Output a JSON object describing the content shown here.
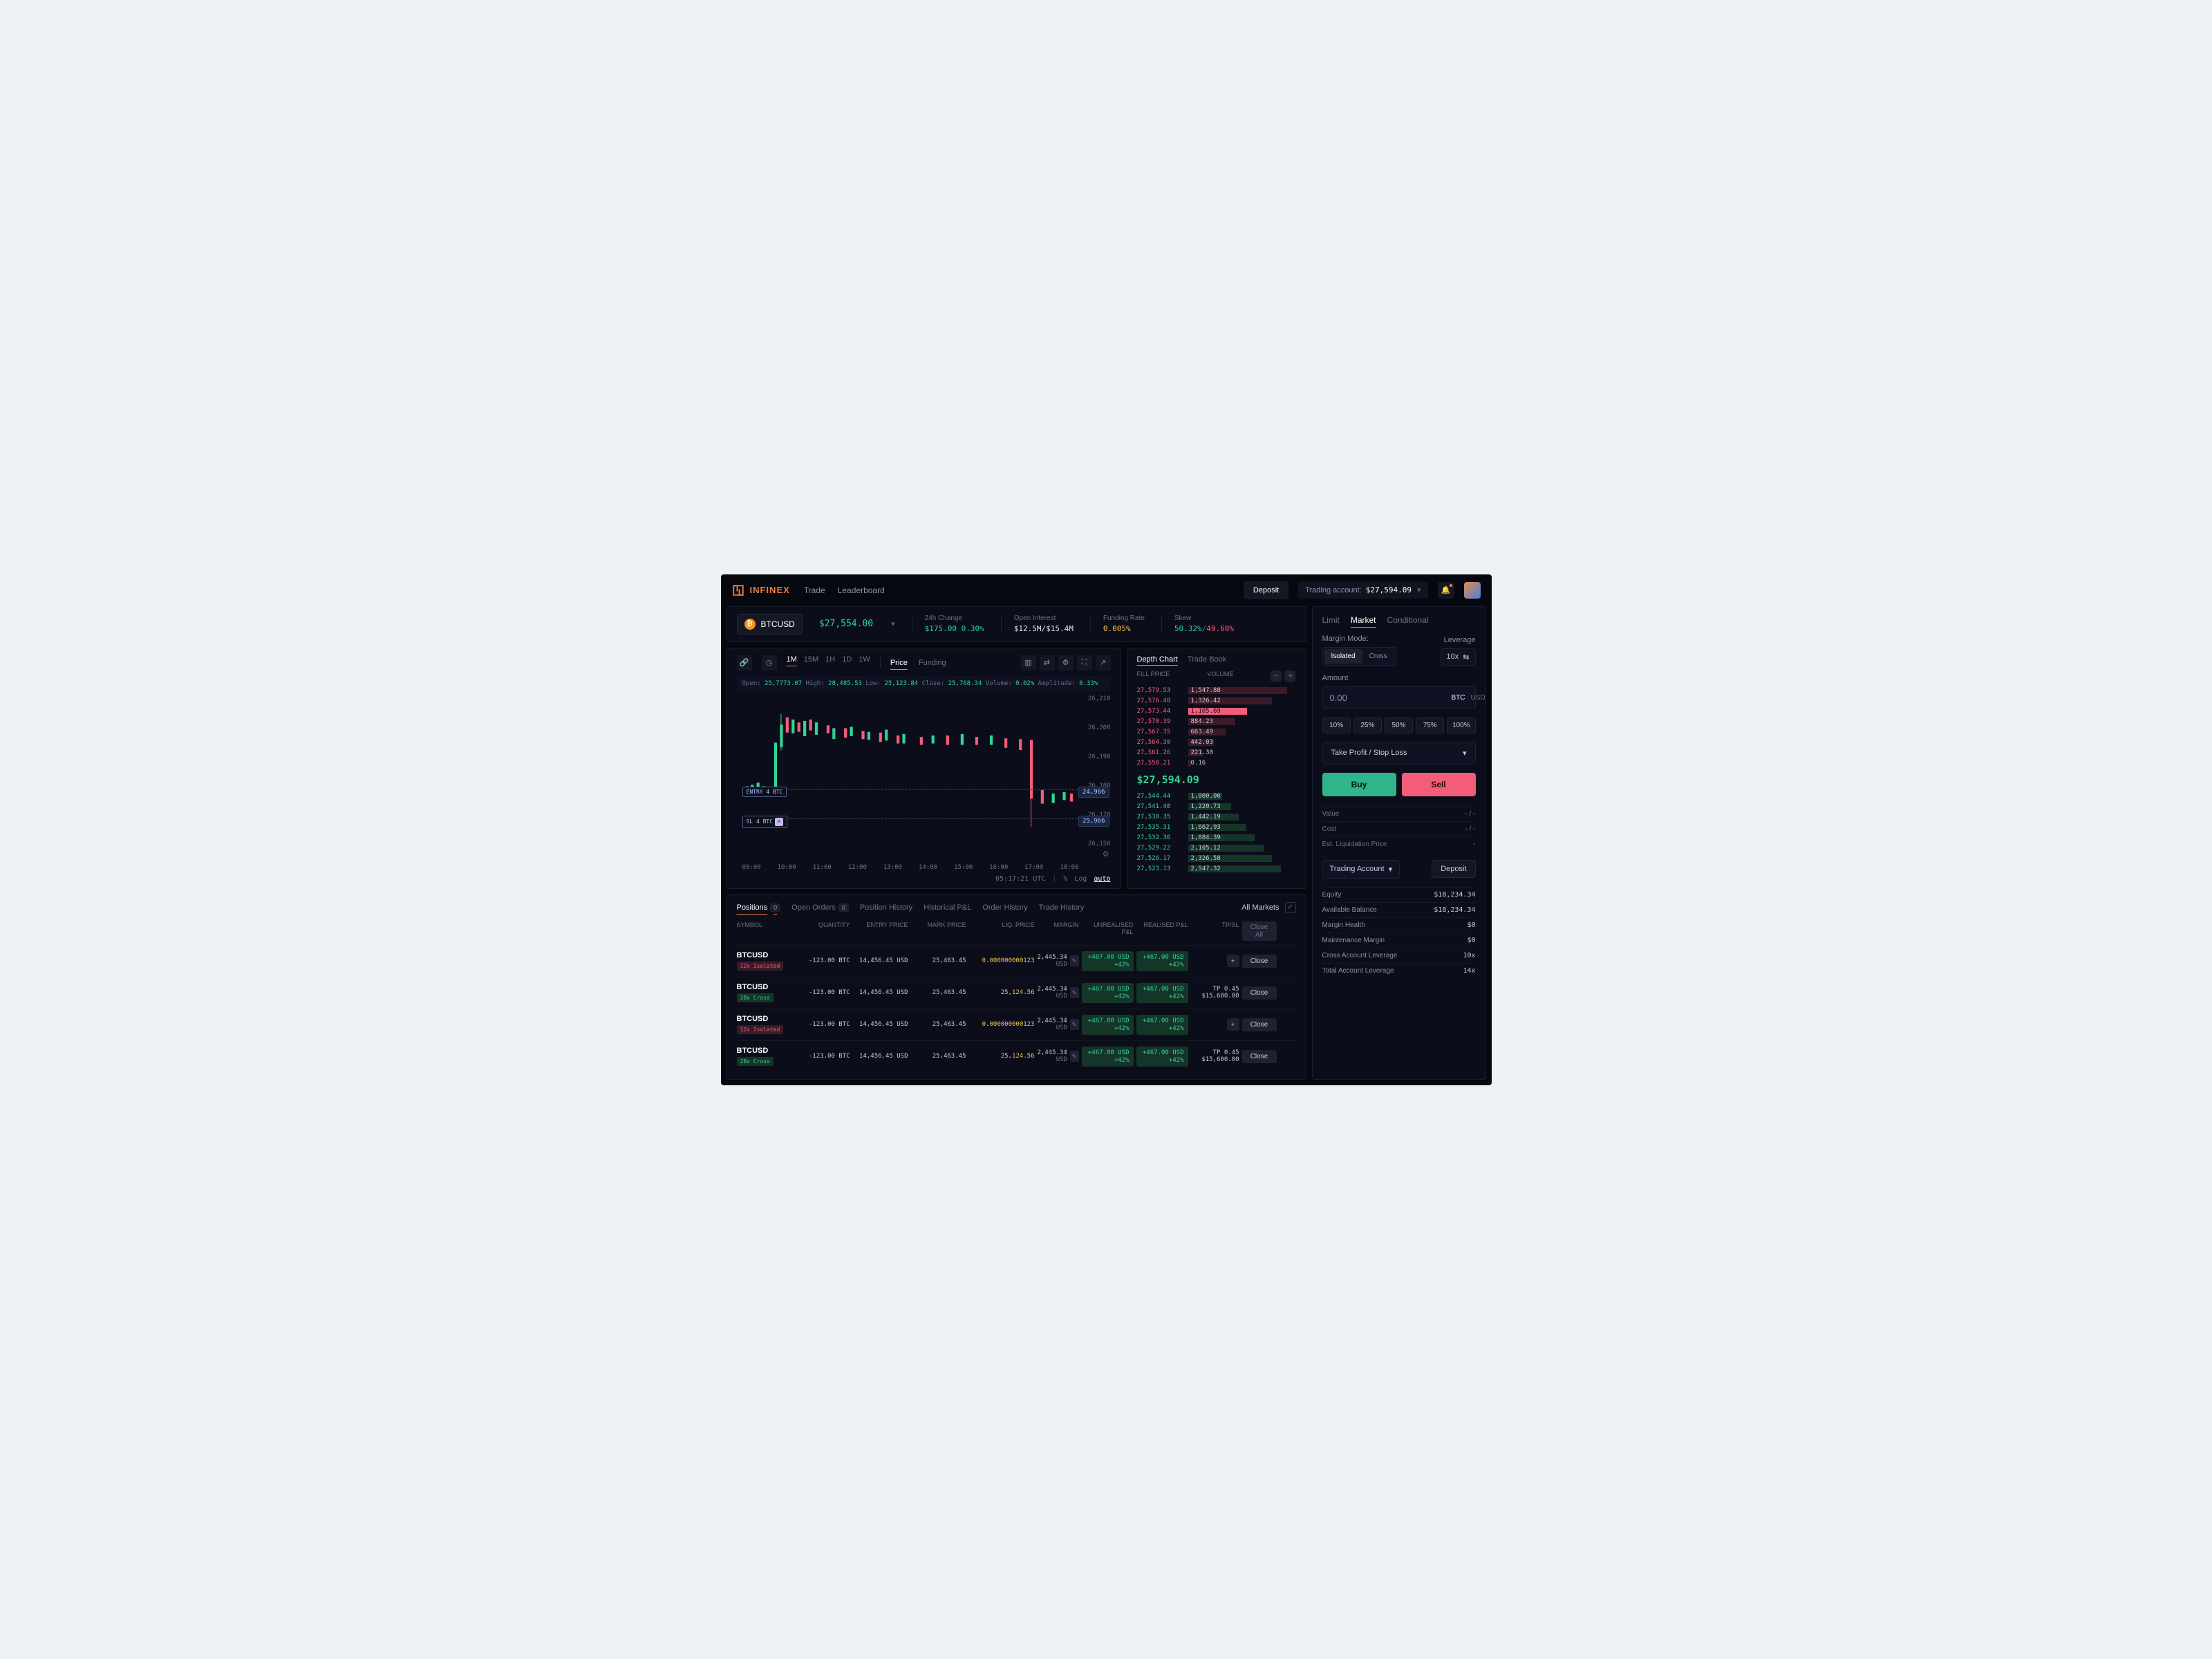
{
  "brand": "INFINEX",
  "nav": {
    "trade": "Trade",
    "leaderboard": "Leaderboard"
  },
  "header": {
    "deposit": "Deposit",
    "account_label": "Trading account:",
    "account_value": "$27,594.09"
  },
  "market": {
    "pair": "BTCUSD",
    "price": "$27,554.00",
    "stats": {
      "change_label": "24h Change",
      "change_value": "$175.00 0.30%",
      "oi_label": "Open Interest",
      "oi_value": "$12.5M/$15.4M",
      "funding_label": "Funding Rate",
      "funding_value": "0.005%",
      "skew_label": "Skew",
      "skew_long": "50.32%",
      "skew_sep": "/",
      "skew_short": "49.68%"
    }
  },
  "chart": {
    "timeframes": [
      "1M",
      "15M",
      "1H",
      "1D",
      "1W"
    ],
    "tf_active": "1M",
    "mode_price": "Price",
    "mode_funding": "Funding",
    "ohlc_open_l": "Open:",
    "ohlc_open": "25,7773.07",
    "ohlc_high_l": "High:",
    "ohlc_high": "28,485.53",
    "ohlc_low_l": "Low:",
    "ohlc_low": "25,123.84",
    "ohlc_close_l": "Close:",
    "ohlc_close": "25,768.34",
    "ohlc_vol_l": "Volume:",
    "ohlc_vol": "0.02%",
    "ohlc_amp_l": "Amplitude:",
    "ohlc_amp": "0.33%",
    "y_ticks": [
      "26,210",
      "26,200",
      "26,190",
      "26,180",
      "26,170",
      "26,150"
    ],
    "price_marker": "24,966",
    "sl_marker": "25,966",
    "entry_label": "ENTRY 4 BTC",
    "sl_label": "SL 4 BTC",
    "x_ticks": [
      "09:00",
      "10:00",
      "11:00",
      "12:00",
      "13:00",
      "14:00",
      "15:00",
      "16:00",
      "17:00",
      "18:00"
    ],
    "utc": "05:17:21 UTC",
    "foot_pct": "%",
    "foot_log": "Log",
    "foot_auto": "auto"
  },
  "chart_data": {
    "type": "candlestick",
    "title": "",
    "x": [
      "09:00",
      "10:00",
      "11:00",
      "12:00",
      "13:00",
      "14:00",
      "15:00",
      "16:00",
      "17:00",
      "18:00"
    ],
    "ylim": [
      26140,
      26215
    ],
    "series": [
      {
        "name": "BTCUSD",
        "values_close": [
          26170,
          26195,
          26192,
          26190,
          26188,
          26186,
          26184,
          26180,
          26150,
          26165
        ]
      }
    ],
    "markers": [
      {
        "label": "ENTRY 4 BTC",
        "y": 24966
      },
      {
        "label": "SL 4 BTC",
        "y": 25966
      }
    ]
  },
  "depth": {
    "tab_on": "Depth Chart",
    "tab_off": "Trade Book",
    "col_price": "FILL PRICE",
    "col_vol": "VOLUME",
    "asks": [
      {
        "p": "27,579.53",
        "v": "1,547.88",
        "w": 92
      },
      {
        "p": "27,576.48",
        "v": "1,326.42",
        "w": 78
      },
      {
        "p": "27,573.44",
        "v": "1,105.69",
        "w": 55,
        "hl": true
      },
      {
        "p": "27,570.39",
        "v": "884.23",
        "w": 44
      },
      {
        "p": "27,567.35",
        "v": "663.49",
        "w": 35
      },
      {
        "p": "27,564.30",
        "v": "442.03",
        "w": 24
      },
      {
        "p": "27,561.26",
        "v": "221.30",
        "w": 14
      },
      {
        "p": "27,558.21",
        "v": "0.16",
        "w": 3
      }
    ],
    "mid": "$27,594.09",
    "bids": [
      {
        "p": "27,544.44",
        "v": "1,000.00",
        "w": 32
      },
      {
        "p": "27,541.40",
        "v": "1,220.73",
        "w": 40
      },
      {
        "p": "27,538.35",
        "v": "1,442.19",
        "w": 47
      },
      {
        "p": "27,535.31",
        "v": "1,662,93",
        "w": 54
      },
      {
        "p": "27,532.36",
        "v": "1,884.39",
        "w": 62
      },
      {
        "p": "27,529.22",
        "v": "2,105.12",
        "w": 70
      },
      {
        "p": "27,526.17",
        "v": "2,326.58",
        "w": 78
      },
      {
        "p": "27,523.13",
        "v": "2,547.32",
        "w": 86
      }
    ]
  },
  "positions": {
    "tabs": {
      "positions": "Positions",
      "positions_count": "0",
      "open": "Open Orders",
      "open_count": "0",
      "phist": "Position History",
      "hpnl": "Historical P&L",
      "ohist": "Order History",
      "thist": "Trade History"
    },
    "all_markets": "All Markets",
    "cols": {
      "symbol": "SYMBOL",
      "qty": "QUANTITY",
      "entry": "ENTRY PRICE",
      "mark": "MARK PRICE",
      "liq": "LIQ. PRICE",
      "margin": "MARGIN",
      "upnl": "UNREALISED P&L",
      "rpnl": "REALISED P&L",
      "tpsl": "TP/SL",
      "closeall": "Close All"
    },
    "rows": [
      {
        "sym": "BTCUSD",
        "lev": "12x Isolated",
        "lev_kind": "r",
        "qty": "-123.00 BTC",
        "entry": "14,456.45 USD",
        "mark": "25,463.45",
        "liq": "0.000000000123",
        "liq_kind": "y",
        "margin": "2,445.34",
        "margin_ccy": "USD",
        "upnl": "+467.00 USD",
        "upnl_pct": "+42%",
        "rpnl": "+467.00 USD",
        "rpnl_pct": "+42%",
        "tpsl_kind": "plus",
        "close": "Close"
      },
      {
        "sym": "BTCUSD",
        "lev": "28x Cross",
        "lev_kind": "g",
        "qty": "-123.00 BTC",
        "entry": "14,456.45 USD",
        "mark": "25,463.45",
        "liq": "25,124.56",
        "liq_kind": "y",
        "margin": "2,445.34",
        "margin_ccy": "USD",
        "upnl": "+467.00 USD",
        "upnl_pct": "+42%",
        "rpnl": "+467.00 USD",
        "rpnl_pct": "+42%",
        "tpsl_kind": "vals",
        "tp": "TP 0.45",
        "sl": "$15,600.00",
        "close": "Close"
      },
      {
        "sym": "BTCUSD",
        "lev": "12x Isolated",
        "lev_kind": "r",
        "qty": "-123.00 BTC",
        "entry": "14,456.45 USD",
        "mark": "25,463.45",
        "liq": "0.000000000123",
        "liq_kind": "y",
        "margin": "2,445.34",
        "margin_ccy": "USD",
        "upnl": "+467.00 USD",
        "upnl_pct": "+42%",
        "rpnl": "+467.00 USD",
        "rpnl_pct": "+42%",
        "tpsl_kind": "plus",
        "close": "Close"
      },
      {
        "sym": "BTCUSD",
        "lev": "28x Cross",
        "lev_kind": "g",
        "qty": "-123.00 BTC",
        "entry": "14,456.45 USD",
        "mark": "25,463.45",
        "liq": "25,124.56",
        "liq_kind": "y",
        "margin": "2,445.34",
        "margin_ccy": "USD",
        "upnl": "+467.00 USD",
        "upnl_pct": "+42%",
        "rpnl": "+467.00 USD",
        "rpnl_pct": "+42%",
        "tpsl_kind": "vals",
        "tp": "TP 0.45",
        "sl": "$15,600.00",
        "close": "Close"
      }
    ]
  },
  "order": {
    "type_limit": "Limit",
    "type_market": "Market",
    "type_cond": "Conditional",
    "margin_mode": "Margin Mode:",
    "margin_iso": "Isolated",
    "margin_cross": "Cross",
    "lev_label": "Leverage",
    "lev_value": "10x",
    "amount_label": "Amount",
    "amount_value": "0.00",
    "ccy_btc": "BTC",
    "ccy_usd": "USD",
    "pcts": [
      "10%",
      "25%",
      "50%",
      "75%",
      "100%"
    ],
    "tpsl": "Take Profit / Stop Loss",
    "buy": "Buy",
    "sell": "Sell",
    "value_l": "Value",
    "value_v": "- / -",
    "cost_l": "Cost",
    "cost_v": "- / -",
    "eliq_l": "Est. Liquidation Price",
    "eliq_v": "-",
    "acct_sel": "Trading Account",
    "deposit2": "Deposit",
    "rows": [
      {
        "k": "Equity",
        "v": "$18,234.34"
      },
      {
        "k": "Available Balance",
        "v": "$18,234.34"
      },
      {
        "k": "Margin Health",
        "v": "$0"
      },
      {
        "k": "Maintenance Margin",
        "v": "$0"
      },
      {
        "k": "Cross Account Leverage",
        "v": "10x"
      },
      {
        "k": "Total Account Leverage",
        "v": "14x"
      }
    ]
  }
}
